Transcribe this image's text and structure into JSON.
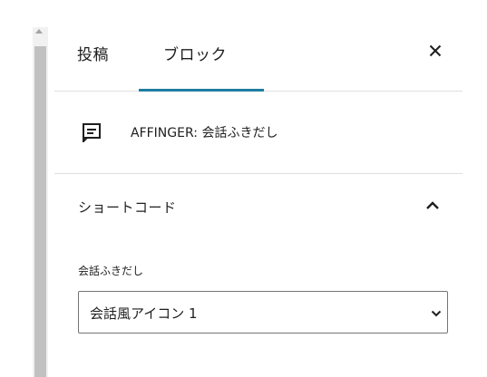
{
  "tabs": {
    "post_label": "投稿",
    "block_label": "ブロック",
    "active": "block",
    "close_icon": "close-icon"
  },
  "block_card": {
    "icon": "block-default-icon",
    "title": "AFFINGER: 会話ふきだし"
  },
  "shortcode_section": {
    "title": "ショートコード",
    "expanded": true,
    "field": {
      "label": "会話ふきだし",
      "selected_value": "会話風アイコン 1"
    }
  },
  "colors": {
    "accent": "#1f7ea1",
    "divider": "#e0e0e0",
    "text": "#1e1e1e"
  }
}
